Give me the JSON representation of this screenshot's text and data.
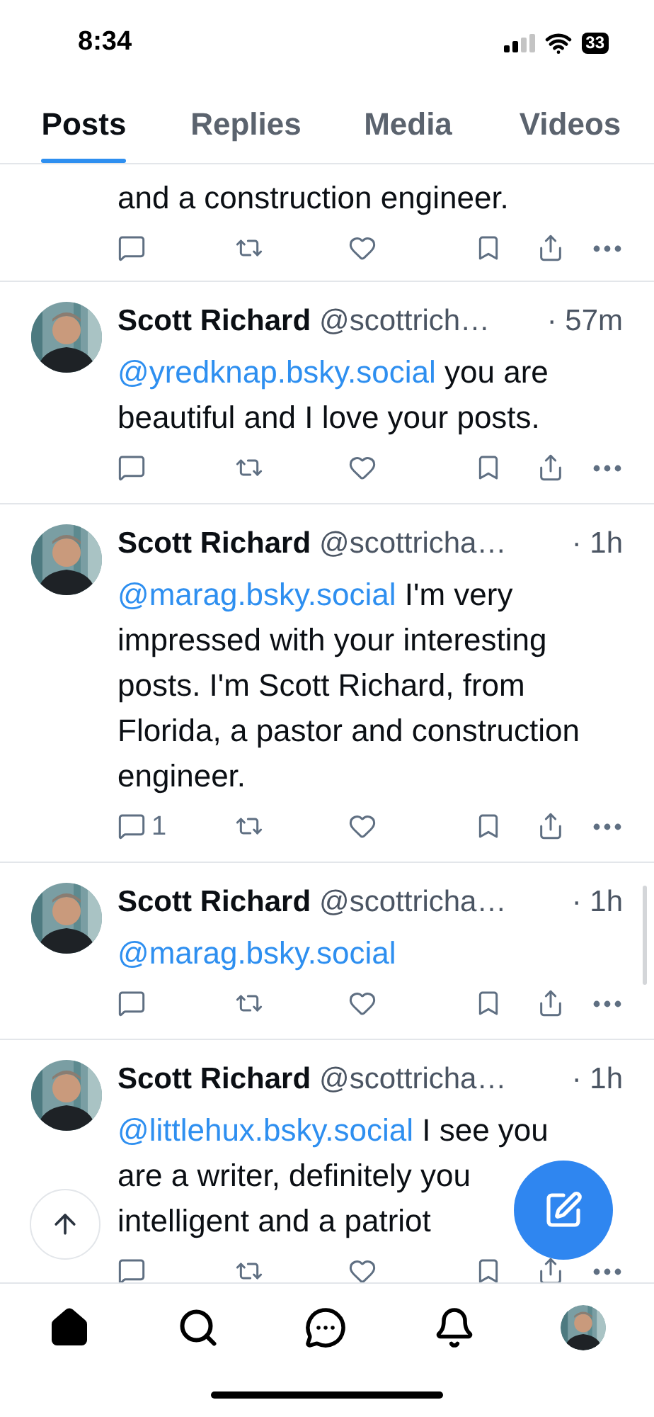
{
  "status_bar": {
    "time": "8:34",
    "battery": "33"
  },
  "tabs": [
    {
      "label": "Posts",
      "selected": true
    },
    {
      "label": "Replies",
      "selected": false
    },
    {
      "label": "Media",
      "selected": false
    },
    {
      "label": "Videos",
      "selected": false
    }
  ],
  "partial_post": {
    "text": "and a construction engineer."
  },
  "posts": [
    {
      "name": "Scott Richard",
      "handle": "@scottrich…",
      "time": "· 57m",
      "mention": "@yredknap.bsky.social",
      "text": "you are beautiful and I love your posts."
    },
    {
      "name": "Scott Richard",
      "handle": "@scottricha…",
      "time": "· 1h",
      "mention": "@marag.bsky.social",
      "text": "I'm very impressed with your interesting posts. I'm Scott Richard, from Florida, a pastor and construction engineer.",
      "reply_count": "1"
    },
    {
      "name": "Scott Richard",
      "handle": "@scottricha…",
      "time": "· 1h",
      "mention": "@marag.bsky.social"
    },
    {
      "name": "Scott Richard",
      "handle": "@scottricha…",
      "time": "· 1h",
      "mention": "@littlehux.bsky.social",
      "text": "I see you are a writer, definitely you intelligent and a patriot"
    }
  ]
}
